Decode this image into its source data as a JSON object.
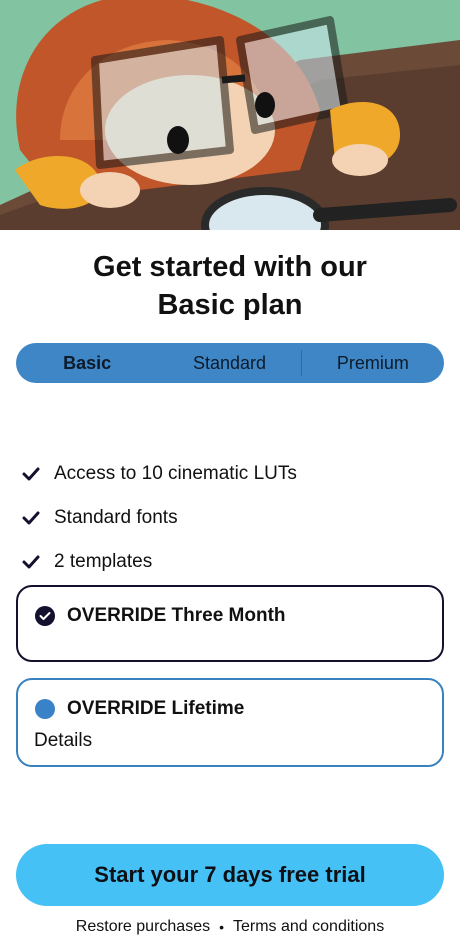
{
  "hero": {
    "image": "child-with-glasses-and-magnifying-glass-illustration"
  },
  "title": {
    "line1": "Get started with our",
    "line2": "Basic plan"
  },
  "tabs": [
    {
      "label": "Basic",
      "active": true
    },
    {
      "label": "Standard",
      "active": false
    },
    {
      "label": "Premium",
      "active": false
    }
  ],
  "features": [
    {
      "icon": "checkmark-icon",
      "text": "Access to 10 cinematic LUTs"
    },
    {
      "icon": "checkmark-icon",
      "text": "Standard fonts"
    },
    {
      "icon": "checkmark-icon",
      "text": "2 templates"
    }
  ],
  "options": [
    {
      "name": "OVERRIDE Three Month",
      "selected": true,
      "details": ""
    },
    {
      "name": "OVERRIDE Lifetime",
      "selected": false,
      "details": "Details"
    }
  ],
  "cta": {
    "label": "Start your 7 days free trial"
  },
  "footer": {
    "restore": "Restore purchases",
    "separator": "•",
    "terms": "Terms and conditions"
  },
  "colors": {
    "tab_bg": "#3e86c6",
    "cta_bg": "#45c1f5",
    "selected_border": "#14112e",
    "option_border": "#3a82bf"
  }
}
